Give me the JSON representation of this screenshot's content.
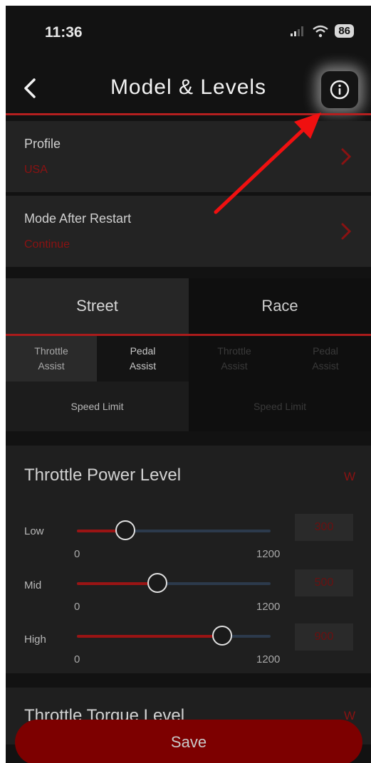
{
  "status_bar": {
    "time": "11:36",
    "battery": "86"
  },
  "header": {
    "title": "Model & Levels"
  },
  "rows": [
    {
      "label": "Profile",
      "value": "USA"
    },
    {
      "label": "Mode After Restart",
      "value": "Continue"
    }
  ],
  "mode_tabs": [
    {
      "label": "Street",
      "active": true
    },
    {
      "label": "Race",
      "active": false
    }
  ],
  "street_subtabs": {
    "throttle_assist": [
      "Throttle",
      "Assist"
    ],
    "pedal_assist": [
      "Pedal",
      "Assist"
    ],
    "speed_limit": "Speed Limit"
  },
  "race_subtabs": {
    "throttle_assist": [
      "Throttle",
      "Assist"
    ],
    "pedal_assist": [
      "Pedal",
      "Assist"
    ],
    "speed_limit": "Speed Limit"
  },
  "throttle_power": {
    "title": "Throttle Power Level",
    "unit": "W",
    "levels": [
      {
        "label": "Low",
        "min": "0",
        "max": "1200",
        "value": 300
      },
      {
        "label": "Mid",
        "min": "0",
        "max": "1200",
        "value": 500
      },
      {
        "label": "High",
        "min": "0",
        "max": "1200",
        "value": 900
      }
    ]
  },
  "next_section": {
    "title": "Throttle Torque Level",
    "unit": "W"
  },
  "save_label": "Save",
  "colors": {
    "accent": "#b41f1f",
    "save_bg": "#7d0000",
    "track": "#2c3a4c"
  }
}
